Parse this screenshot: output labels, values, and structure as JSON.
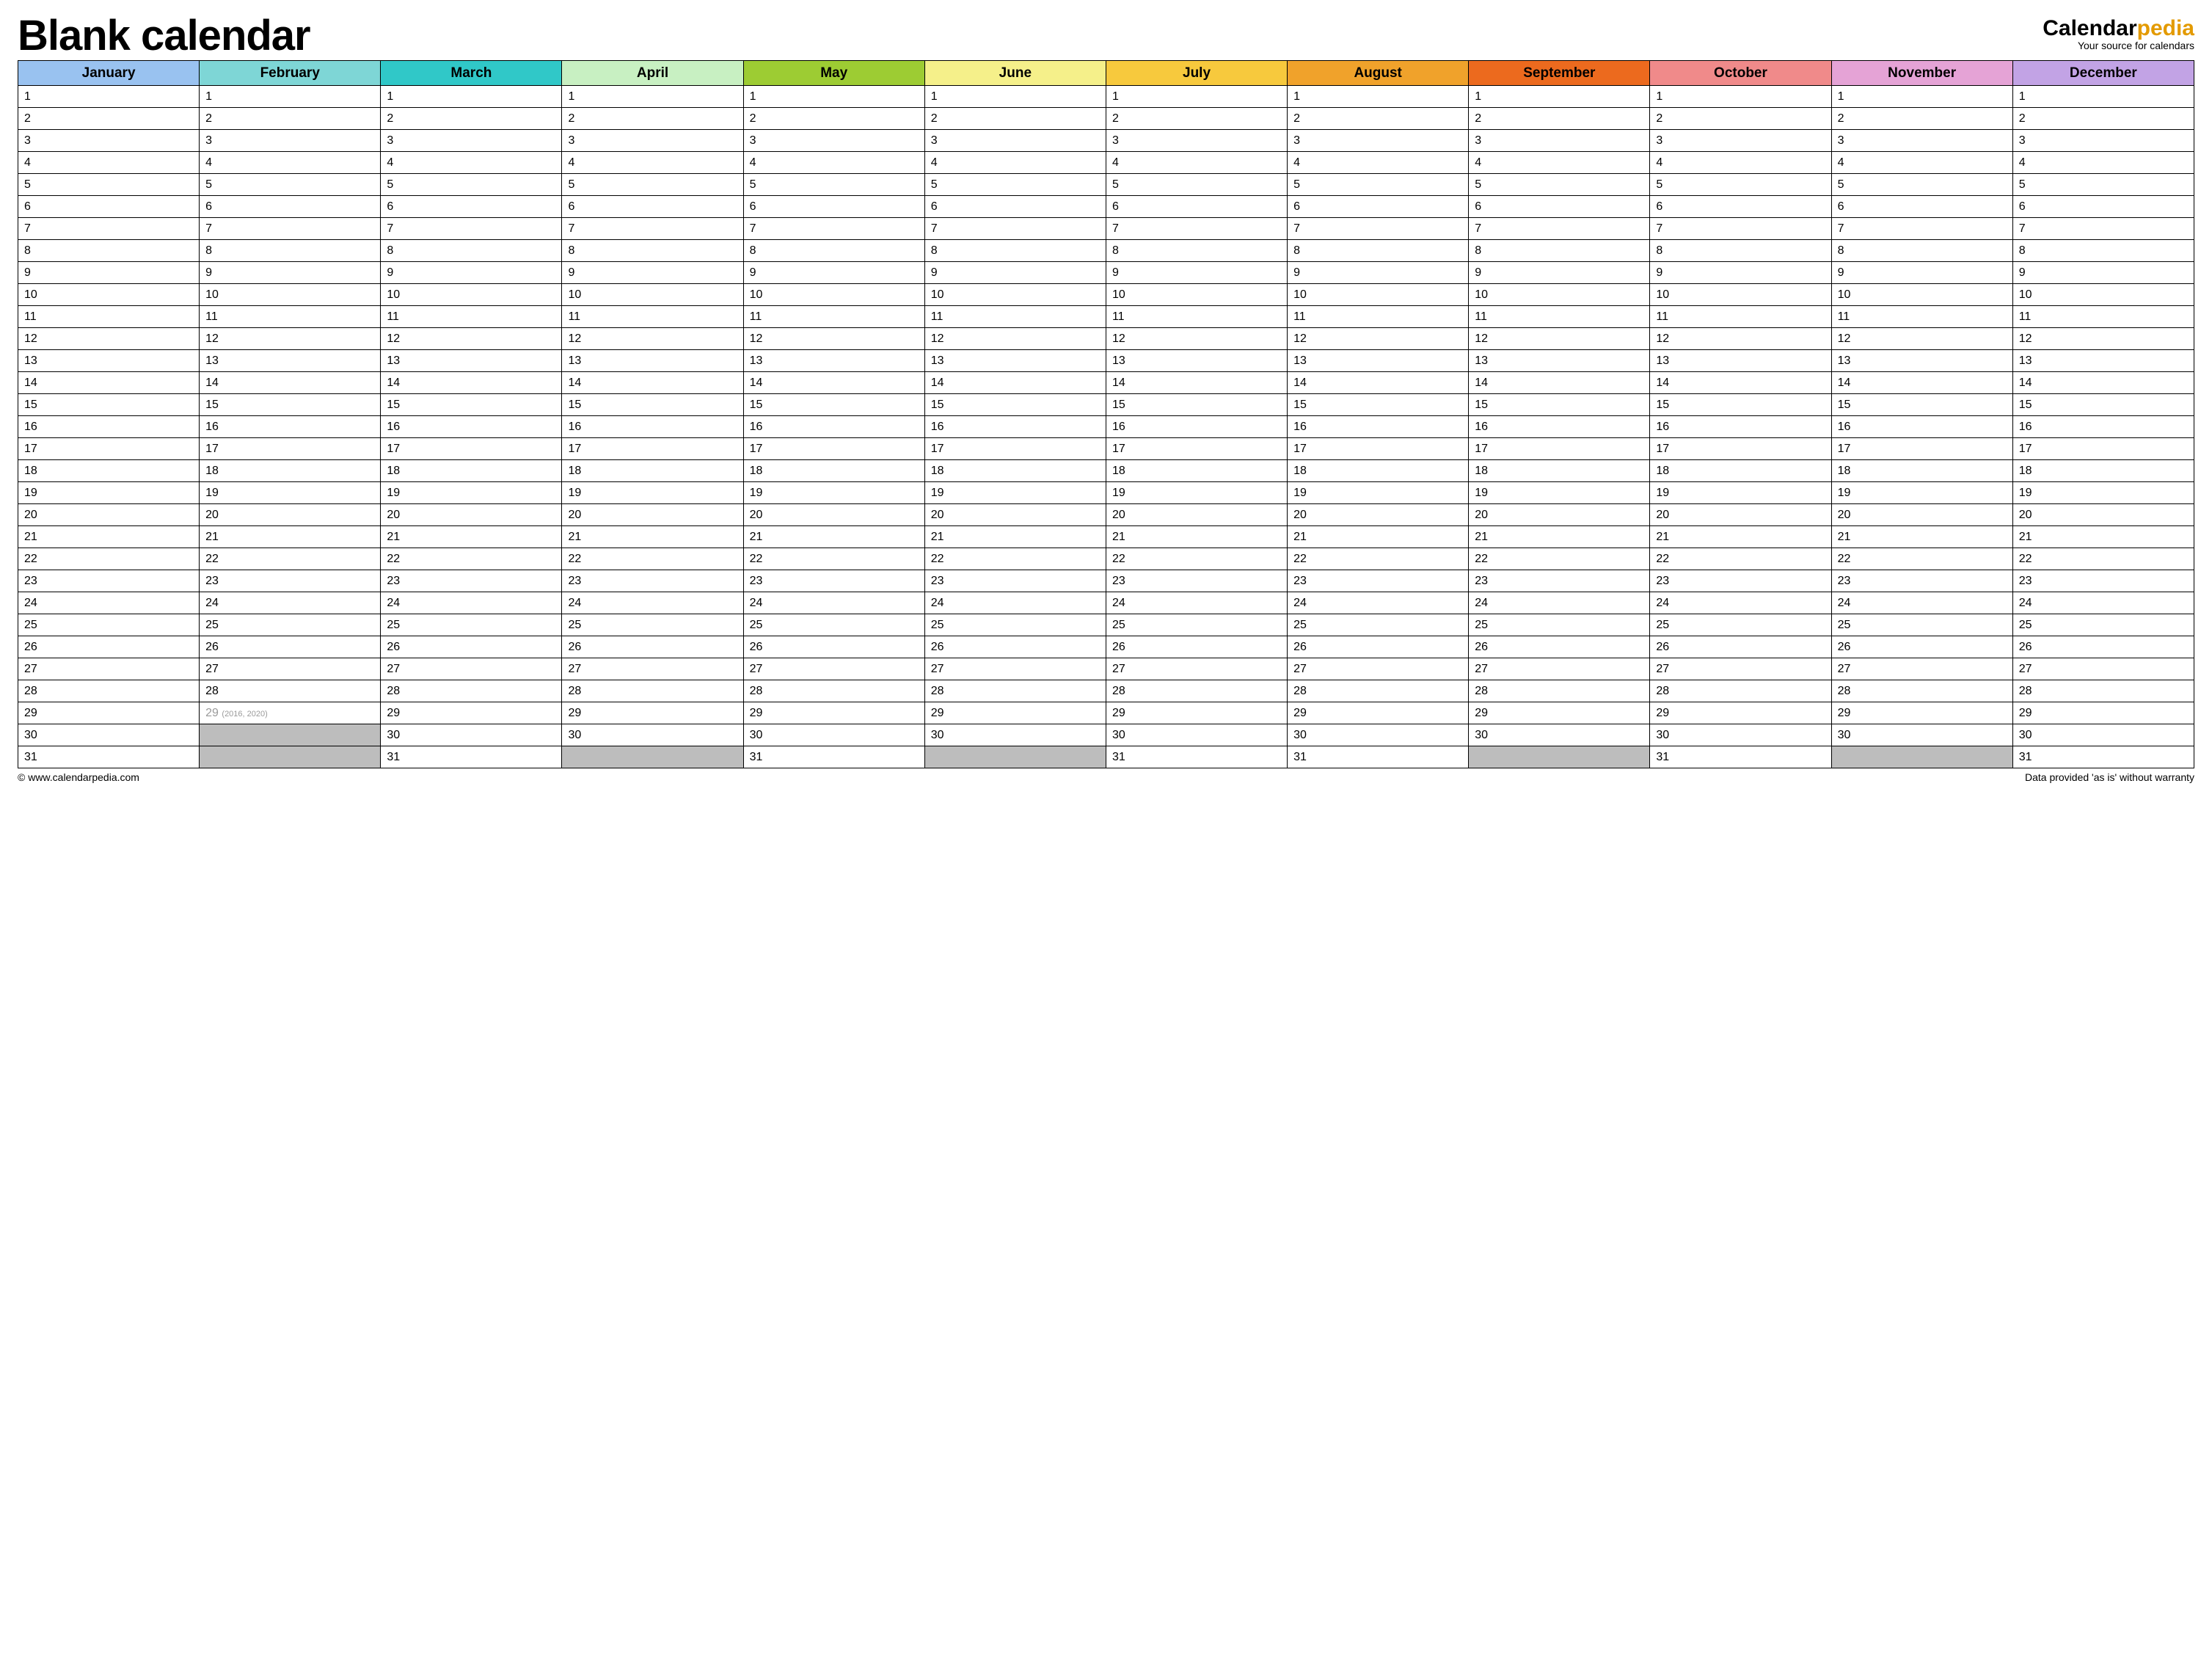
{
  "header": {
    "title": "Blank calendar",
    "brand_prefix": "Calendar",
    "brand_suffix": "pedia",
    "brand_tag": "Your source for calendars"
  },
  "months": [
    {
      "name": "January",
      "color": "#99c2f0",
      "days": 31
    },
    {
      "name": "February",
      "color": "#7ed6d6",
      "days": 28,
      "leap_day": 29,
      "leap_note": "(2016, 2020)"
    },
    {
      "name": "March",
      "color": "#30c8c8",
      "days": 31
    },
    {
      "name": "April",
      "color": "#c8f0c2",
      "days": 30
    },
    {
      "name": "May",
      "color": "#9dcc33",
      "days": 31
    },
    {
      "name": "June",
      "color": "#f5f08a",
      "days": 30
    },
    {
      "name": "July",
      "color": "#f7c93d",
      "days": 31
    },
    {
      "name": "August",
      "color": "#f0a22b",
      "days": 31
    },
    {
      "name": "September",
      "color": "#ec6a1e",
      "days": 30
    },
    {
      "name": "October",
      "color": "#f08a8a",
      "days": 31
    },
    {
      "name": "November",
      "color": "#e5a3d6",
      "days": 30
    },
    {
      "name": "December",
      "color": "#c2a3e5",
      "days": 31
    }
  ],
  "max_rows": 31,
  "footer": {
    "left": "© www.calendarpedia.com",
    "right": "Data provided 'as is' without warranty"
  }
}
